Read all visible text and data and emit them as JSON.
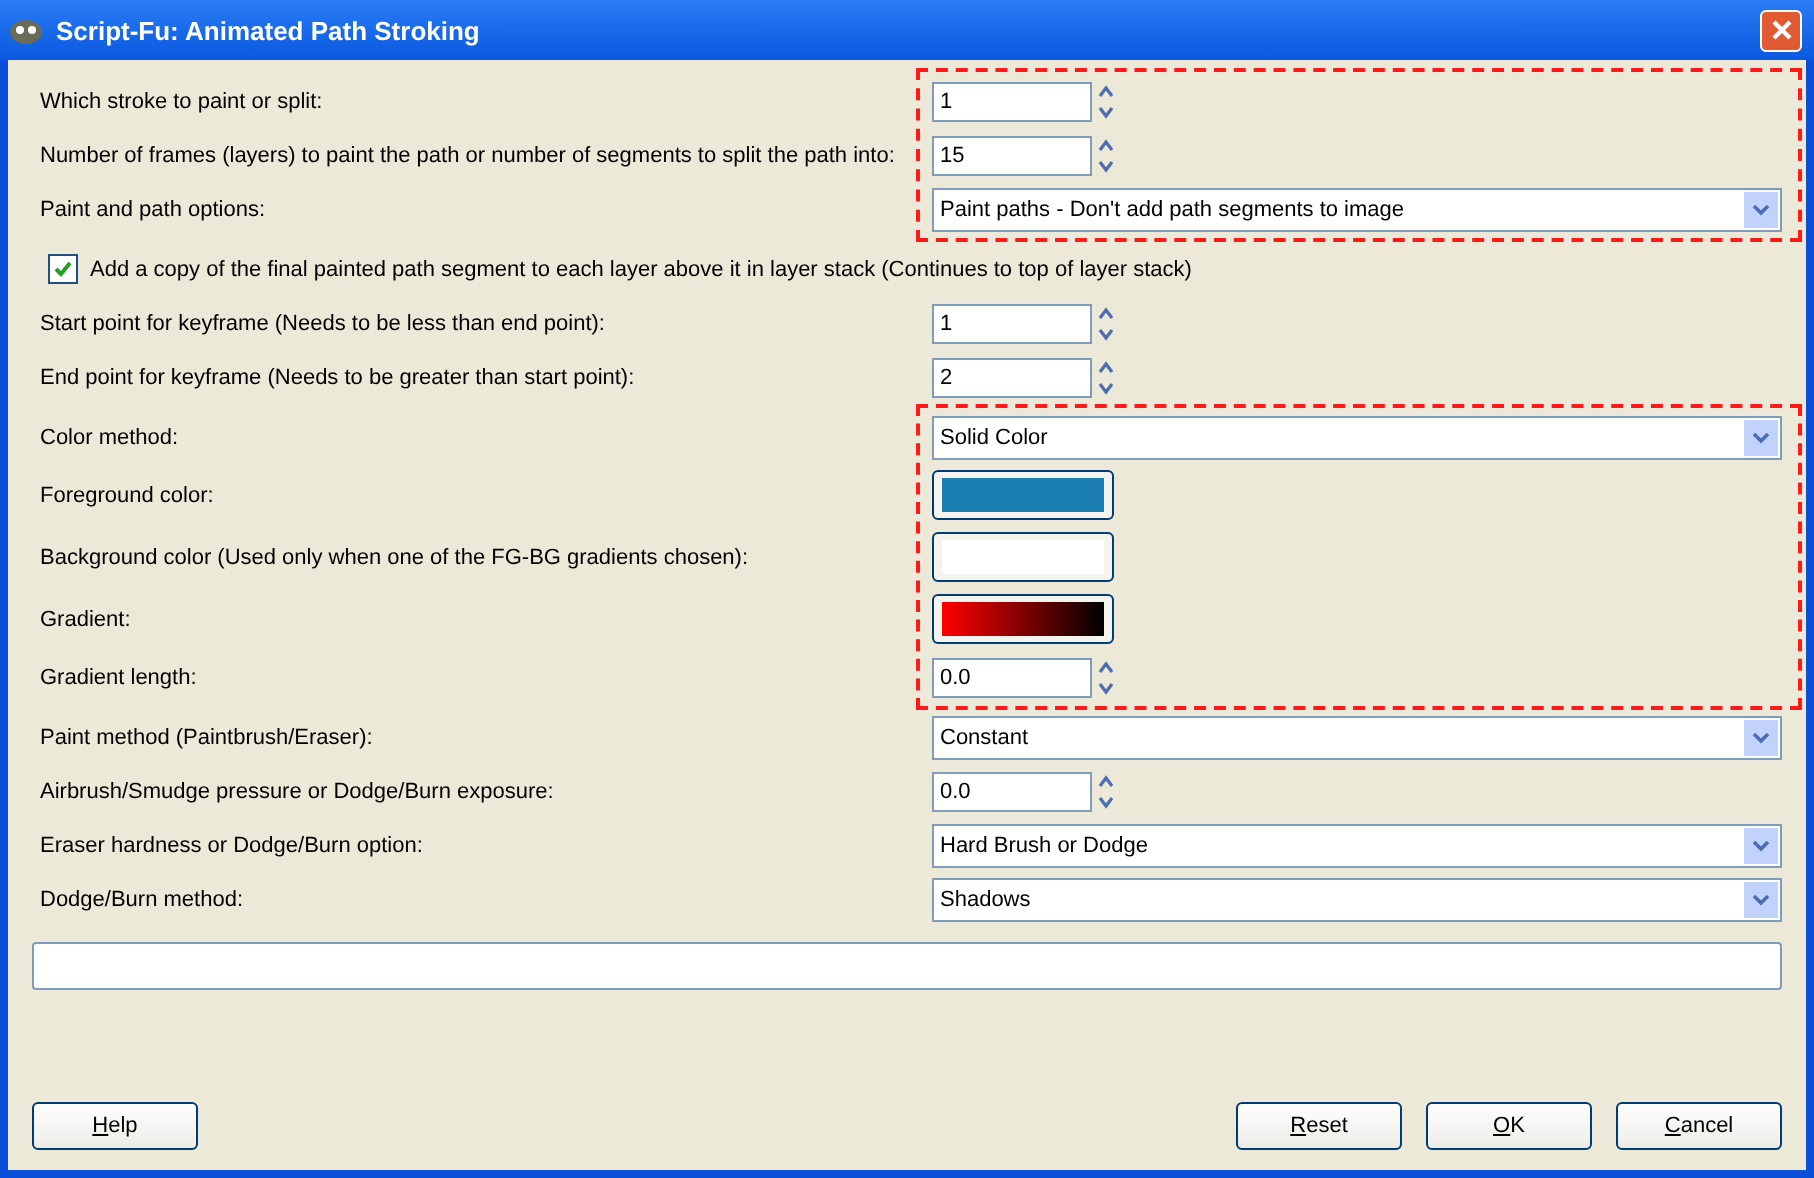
{
  "window": {
    "title": "Script-Fu: Animated Path Stroking"
  },
  "groups": [
    {
      "highlighted": true,
      "rows": [
        {
          "kind": "spin",
          "label": "Which stroke to paint or split:",
          "value": "1"
        },
        {
          "kind": "spin",
          "label": "Number of frames (layers) to paint the path or number of segments to split the path into:",
          "value": "15"
        },
        {
          "kind": "combo",
          "label": "Paint and path options:",
          "value": "Paint paths - Don't add path segments to image"
        }
      ]
    },
    {
      "highlighted": false,
      "rows": [
        {
          "kind": "checkbox",
          "label": "Add a copy of the final painted path segment to each layer above it in layer stack (Continues to top of layer stack)",
          "checked": true
        },
        {
          "kind": "spin",
          "label": "Start point for keyframe (Needs to be less than end point):",
          "value": "1"
        },
        {
          "kind": "spin",
          "label": "End point for keyframe (Needs to be greater than start point):",
          "value": "2"
        }
      ]
    },
    {
      "highlighted": true,
      "rows": [
        {
          "kind": "combo",
          "label": "Color method:",
          "value": "Solid Color"
        },
        {
          "kind": "color",
          "label": "Foreground color:",
          "color": "#1a7fb0"
        },
        {
          "kind": "color",
          "label": "Background color (Used only when one of the FG-BG gradients chosen):",
          "color": "#ffffff"
        },
        {
          "kind": "gradient",
          "label": "Gradient:"
        },
        {
          "kind": "spin",
          "label": "Gradient length:",
          "value": "0.0"
        }
      ]
    },
    {
      "highlighted": false,
      "rows": [
        {
          "kind": "combo",
          "label": "Paint method (Paintbrush/Eraser):",
          "value": "Constant"
        },
        {
          "kind": "spin",
          "label": "Airbrush/Smudge pressure or Dodge/Burn exposure:",
          "value": "0.0"
        },
        {
          "kind": "combo",
          "label": "Eraser hardness or Dodge/Burn option:",
          "value": "Hard Brush or Dodge"
        },
        {
          "kind": "combo",
          "label": "Dodge/Burn method:",
          "value": "Shadows"
        }
      ]
    }
  ],
  "left_buttons": [
    "Help"
  ],
  "right_buttons": [
    "Reset",
    "OK",
    "Cancel"
  ]
}
